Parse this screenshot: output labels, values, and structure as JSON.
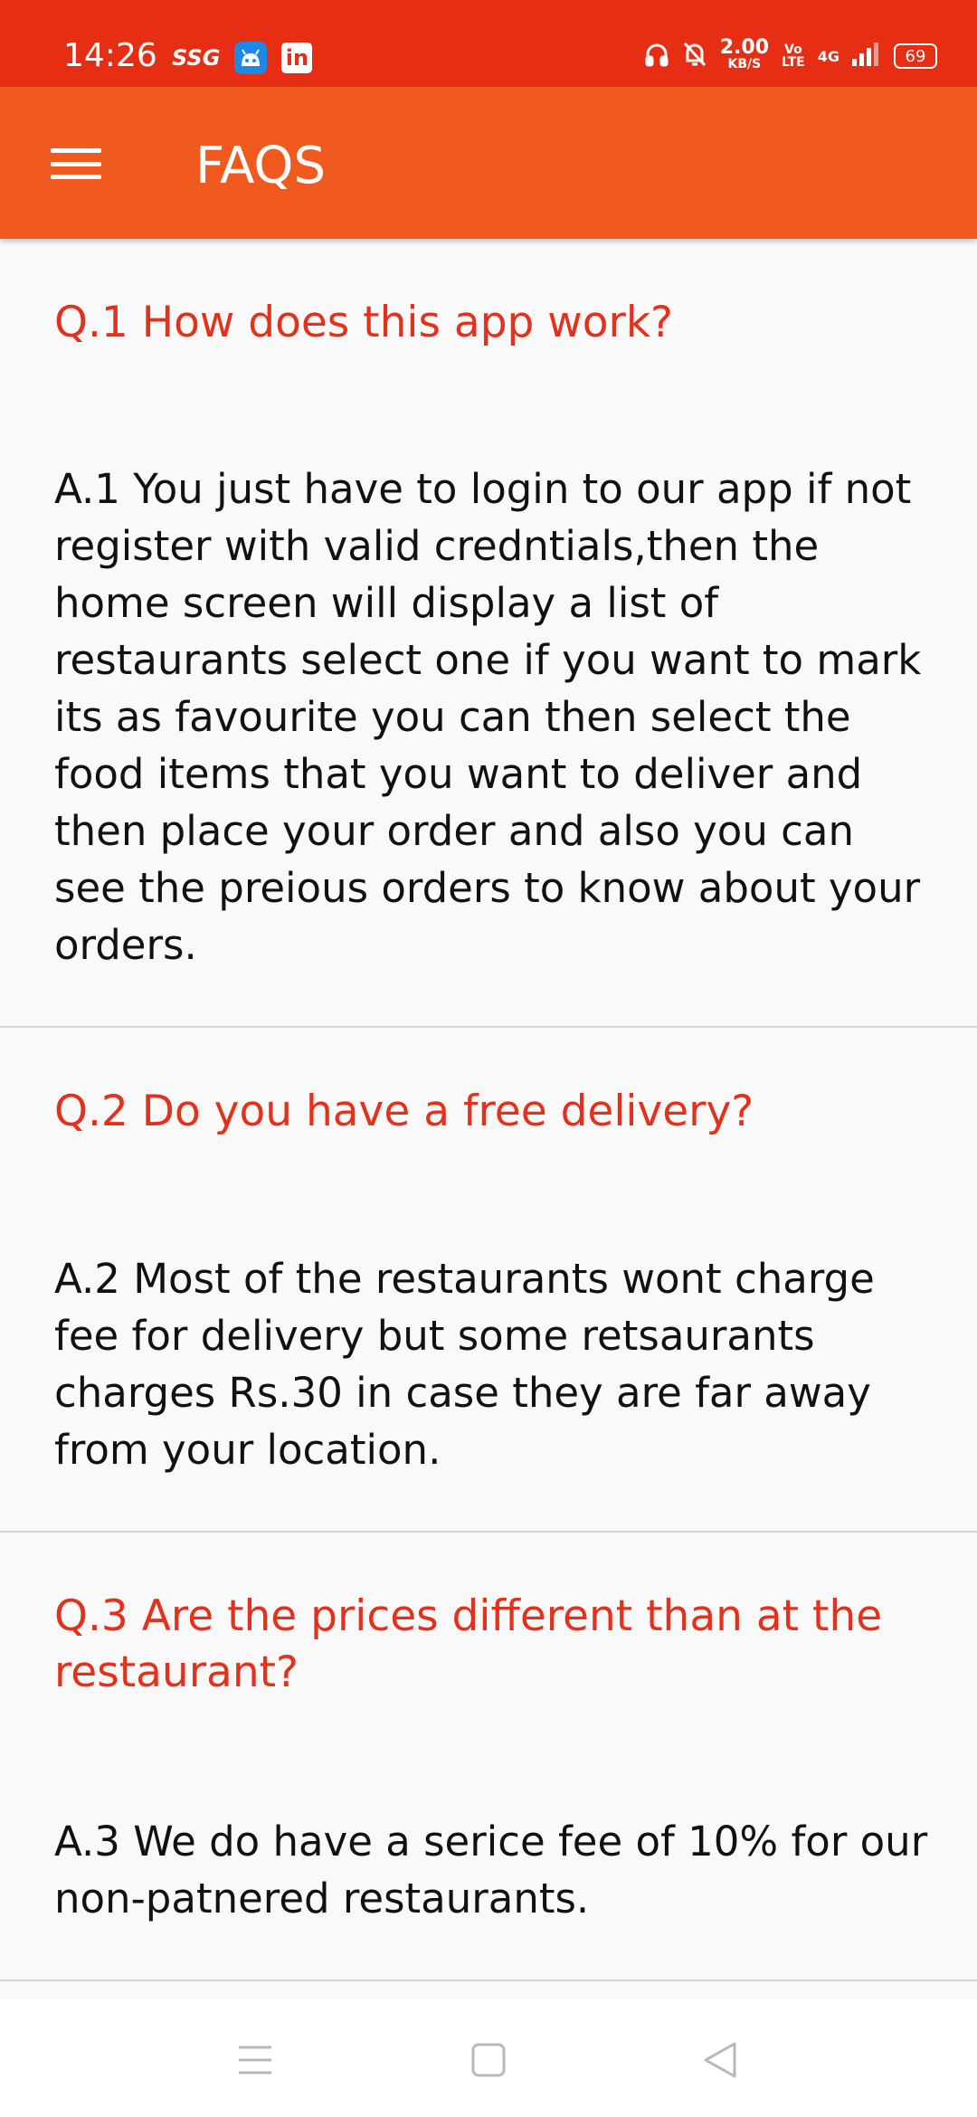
{
  "status_bar": {
    "time": "14:26",
    "carrier_tag": "SSG",
    "linkedin_glyph": "in",
    "speed_value": "2.00",
    "speed_unit": "KB/S",
    "volte_top": "Vo",
    "volte_bottom": "LTE",
    "network": "4G",
    "battery_level": "69",
    "icons": [
      "android-bot-icon",
      "linkedin-icon",
      "headphone-icon",
      "bell-mute-icon",
      "signal-icon",
      "battery-icon"
    ]
  },
  "app_bar": {
    "title": "FAQS",
    "menu_icon": "hamburger-menu-icon"
  },
  "faqs": [
    {
      "question": "Q.1  How does this app work?",
      "answer": "A.1  You just have to login to our app if not register with valid credntials,then the home screen will display a list of restaurants select one if you want to mark its as favourite you can then select the food items that you want to deliver and then place your order and also you can see the preious orders to know about your orders."
    },
    {
      "question": "Q.2  Do you have a free delivery?",
      "answer": "A.2  Most of the restaurants wont charge fee for delivery but some retsaurants charges Rs.30 in case they are far away from your location."
    },
    {
      "question": "Q.3  Are the prices different than at the restaurant?",
      "answer": "A.3  We do have a serice fee of 10% for our non-patnered restaurants."
    }
  ],
  "nav_bar": {
    "icons": [
      "recents-icon",
      "home-icon",
      "back-icon"
    ]
  },
  "colors": {
    "status_bar": "#e62e14",
    "app_bar": "#f05a1e",
    "question_text": "#e3311c",
    "background": "#f9f9f9"
  }
}
